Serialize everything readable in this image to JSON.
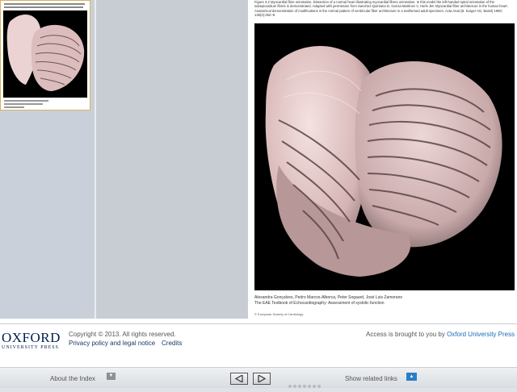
{
  "document": {
    "caption": "Figure 3.2 Myocardial fibre orientation. Dissection of a normal heart illustrating myocardial fibres orientation. In this model the left-handed spiral orientation of the subepicardium fibres is demonstrated. Adapted with permission from Sanchez-Quintana D, Garcia-Martinez V, Hurle JM. Myocardial fiber architecture in the human heart. Anatomical demonstration of modifications in the normal pattern of ventricular fiber architecture in a malformed adult specimen. Acta Anat (B. Karger AG, Basel) 1990; 138(4):352–8.",
    "authors": "Alexandra Gonçalves, Pedro Marcos-Alberca, Peter Sogaard, José Luis Zamorano",
    "book": "The EAE Textbook of Echocardiography: Assessment of systolic function",
    "copyright_small": "© European Society of Cardiology"
  },
  "footer": {
    "logo_word": "OXFORD",
    "logo_sub": "UNIVERSITY PRESS",
    "copyright": "Copyright © 2013. All rights reserved.",
    "privacy": "Privacy policy and legal notice",
    "credits": "Credits",
    "access_prefix": "Access is brought to you by",
    "access_org": "Oxford University Press -"
  },
  "nav": {
    "about_index": "About the Index",
    "related_links": "Show related links",
    "dot_count": 7
  },
  "colors": {
    "oxford_navy": "#001f4f",
    "link_blue": "#1b6bb8"
  }
}
